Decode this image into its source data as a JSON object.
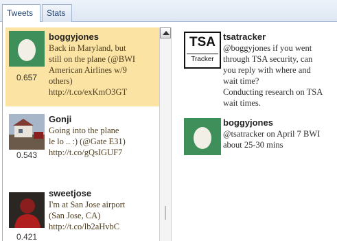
{
  "tabs": [
    {
      "label": "Tweets"
    },
    {
      "label": "Stats"
    }
  ],
  "tweets": [
    {
      "username": "boggyjones",
      "text": "Back in Maryland, but\nstill on the plane (@BWI\nAmerican Airlines w/9\nothers)\nhttp://t.co/exKmO3GT",
      "score": "0.657",
      "highlighted": true,
      "avatar": "egg-icon"
    },
    {
      "username": "Gonji",
      "text": "Going into the plane\nle lo .. :) (@Gate E31)\nhttp://t.co/gQsIGUF7",
      "score": "0.543",
      "highlighted": false,
      "avatar": "photo-icon"
    },
    {
      "username": "sweetjose",
      "text": "I'm at San Jose airport\n(San Jose, CA)\nhttp://t.co/lb2aHvbC",
      "score": "0.421",
      "highlighted": false,
      "avatar": "person-icon"
    }
  ],
  "conversation": [
    {
      "username": "tsatracker",
      "text": "@boggyjones if you went\nthrough TSA security, can\nyou reply with where and\nwait time?\nConducting research on TSA\nwait times.",
      "logo": {
        "big": "TSA",
        "small": "Tracker"
      }
    },
    {
      "username": "boggyjones",
      "text": "@tsatracker on April 7 BWI\nabout 25-30 mins",
      "avatar": "egg-icon"
    }
  ],
  "colors": {
    "highlight": "#fbe3a4",
    "egg_bg": "#3f8f5a",
    "tab_text": "#1a3e70"
  }
}
